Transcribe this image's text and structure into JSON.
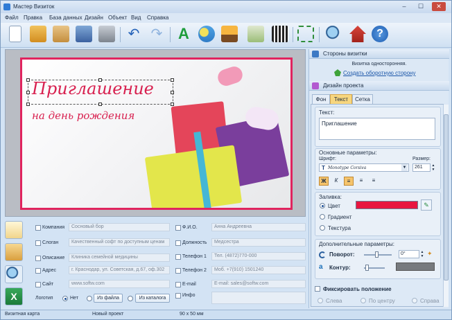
{
  "window": {
    "title": "Мастер Визиток"
  },
  "menu": [
    "Файл",
    "Правка",
    "База данных",
    "Дизайн",
    "Объект",
    "Вид",
    "Справка"
  ],
  "toolbar": {
    "icons": [
      "new-icon",
      "open-icon",
      "paste-icon",
      "save-icon",
      "print-icon",
      "undo-icon",
      "redo-icon",
      "text-icon",
      "shapes-icon",
      "image-icon",
      "map-icon",
      "qrcode-icon",
      "fit-icon",
      "zoom-icon",
      "help-home-icon",
      "help-icon"
    ]
  },
  "card": {
    "title": "Приглашение",
    "subtitle": "на день рождения",
    "border_color": "#e0245e",
    "text_color": "#d8204f"
  },
  "form": {
    "left": [
      {
        "label": "Компания",
        "value": "Сосновый бор"
      },
      {
        "label": "Слоган",
        "value": "Качественный софт по доступным ценам"
      },
      {
        "label": "Описание",
        "value": "Клиника семейной медицины"
      },
      {
        "label": "Адрес",
        "value": "г. Краснодар, ул. Советская, д.67, оф.302"
      },
      {
        "label": "Сайт",
        "value": "www.softw.com"
      }
    ],
    "right": [
      {
        "label": "Ф.И.О.",
        "value": "Анна Андреевна"
      },
      {
        "label": "Должность",
        "value": "Медсестра"
      },
      {
        "label": "Телефон 1",
        "value": "Тел. (4872)770-000"
      },
      {
        "label": "Телефон 2",
        "value": "Моб. +7(910) 1501240"
      },
      {
        "label": "E-mail",
        "value": "E-mail: sales@softw.com"
      },
      {
        "label": "Инфо",
        "value": ""
      }
    ],
    "logo": {
      "label": "Логотип",
      "none": "Нет",
      "from_file": "Из файла",
      "from_catalog": "Из каталога"
    }
  },
  "panel": {
    "sides": {
      "header": "Стороны визитки",
      "info": "Визитка односторонняя.",
      "link": "Создать оборотную сторону"
    },
    "design": {
      "header": "Дизайн проекта"
    },
    "tabs": [
      "Фон",
      "Текст",
      "Сетка"
    ],
    "text": {
      "label": "Текст:",
      "value": "Приглашение"
    },
    "basic": {
      "label": "Основные параметры:",
      "font_label": "Шрифт:",
      "font_value": "Monotype Corsiva",
      "size_label": "Размер:",
      "size_value": "261"
    },
    "fill": {
      "label": "Заливка:",
      "color": "Цвет",
      "gradient": "Градиент",
      "texture": "Текстура",
      "swatch": "#e8153f"
    },
    "extra": {
      "label": "Дополнительные параметры:",
      "rotate": "Поворот:",
      "rotate_value": "0°",
      "outline": "Контур:"
    },
    "fix": {
      "label": "Фиксировать положение",
      "left": "Слева",
      "center": "По центру",
      "right": "Справа"
    }
  },
  "status": {
    "mode": "Визитная карта",
    "project": "Новый проект",
    "size": "90 x 50 мм"
  }
}
